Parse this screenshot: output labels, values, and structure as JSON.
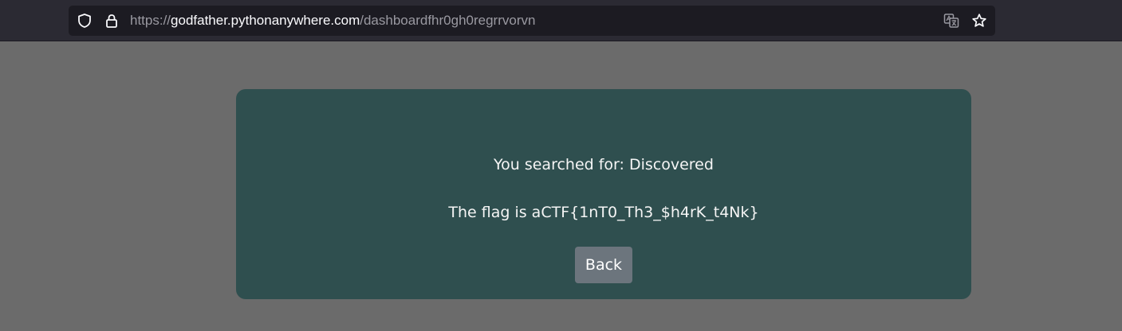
{
  "browser": {
    "url_scheme": "https://",
    "url_host": "godfather.pythonanywhere.com",
    "url_path": "/dashboardfhr0gh0regrrvorvn",
    "icons": [
      "shield-icon",
      "lock-icon",
      "translate-icon",
      "star-icon"
    ]
  },
  "page": {
    "searched_text": "You searched for: Discovered",
    "flag_text": "The flag is aCTF{1nT0_Th3_$h4rK_t4Nk}",
    "back_label": "Back"
  },
  "colors": {
    "page_background": "#6b6b6b",
    "card_background": "#2f4f4f",
    "button_background": "#6c757d",
    "toolbar_background": "#2b2a33"
  }
}
